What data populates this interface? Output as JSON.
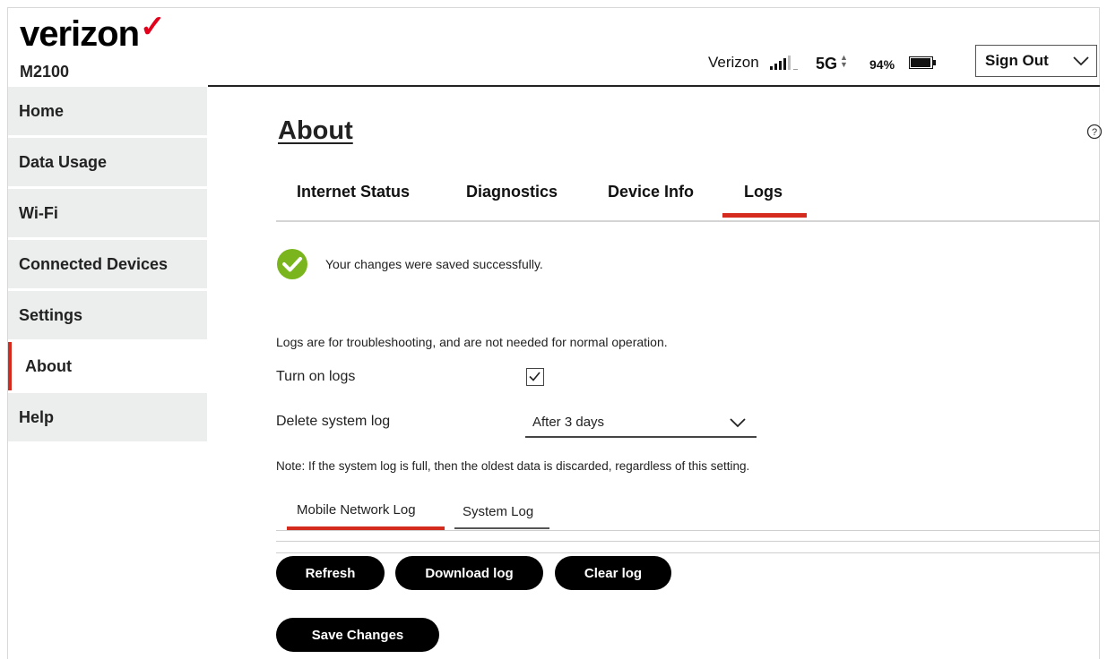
{
  "header": {
    "brand": "verizon",
    "brand_mark": "✓",
    "model": "M2100",
    "carrier": "Verizon",
    "network": "5G",
    "battery": "94%",
    "sign_out": "Sign Out"
  },
  "sidebar": {
    "items": [
      {
        "label": "Home"
      },
      {
        "label": "Data Usage"
      },
      {
        "label": "Wi-Fi"
      },
      {
        "label": "Connected Devices"
      },
      {
        "label": "Settings"
      },
      {
        "label": "About"
      },
      {
        "label": "Help"
      }
    ],
    "active": "About"
  },
  "main": {
    "title": "About",
    "tabs": [
      {
        "label": "Internet Status"
      },
      {
        "label": "Diagnostics"
      },
      {
        "label": "Device Info"
      },
      {
        "label": "Logs"
      }
    ],
    "active_tab": "Logs",
    "success_message": "Your changes were saved successfully.",
    "info": "Logs are for troubleshooting, and are not needed for normal operation.",
    "turn_on_logs_label": "Turn on logs",
    "turn_on_logs_checked": true,
    "delete_log_label": "Delete system log",
    "delete_log_value": "After 3 days",
    "note": "Note: If the system log is full, then the oldest data is discarded, regardless of this setting.",
    "subtabs": [
      {
        "label": "Mobile Network Log"
      },
      {
        "label": "System Log"
      }
    ],
    "active_subtab": "Mobile Network Log",
    "buttons": {
      "refresh": "Refresh",
      "download": "Download log",
      "clear": "Clear log",
      "save": "Save Changes"
    }
  },
  "colors": {
    "accent": "#d52b1e",
    "success": "#7ab51d",
    "sidebar_bg": "#eceded"
  },
  "icons": [
    "signal-bars-icon",
    "battery-icon",
    "chevron-down-icon",
    "help-icon",
    "check-circle-icon",
    "checkmark-icon"
  ]
}
